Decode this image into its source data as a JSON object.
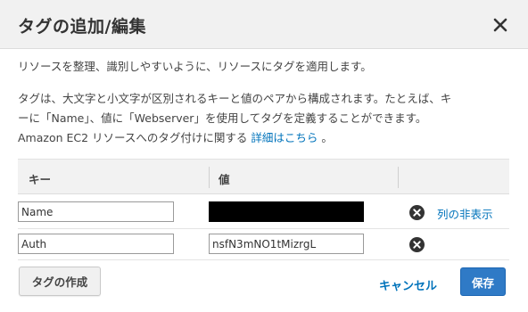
{
  "dialog": {
    "title": "タグの追加/編集"
  },
  "description": {
    "line1": "リソースを整理、識別しやすいように、リソースにタグを適用します。",
    "line2": "タグは、大文字と小文字が区別されるキーと値のペアから構成されます。たとえば、キ",
    "line3": "ーに「Name」、値に「Webserver」を使用してタグを定義することができます。",
    "line4_prefix": "Amazon EC2 リソースへのタグ付けに関する",
    "line4_link": "詳細はこちら",
    "line4_suffix": "。"
  },
  "table": {
    "headers": [
      "キー",
      "値"
    ],
    "rows": [
      {
        "key": "Name",
        "value": ""
      },
      {
        "key": "Auth",
        "value": "nsfN3mNO1tMizrgL"
      }
    ],
    "hide_column_link": "列の非表示"
  },
  "buttons": {
    "create_tag": "タグの作成",
    "cancel": "キャンセル",
    "save": "保存"
  },
  "colors": {
    "link": "#0073bb",
    "primary_button": "#2f7ac6",
    "header_bg": "#f1f1f1"
  },
  "icons": {
    "close": "close-icon",
    "remove": "remove-circle-icon"
  }
}
